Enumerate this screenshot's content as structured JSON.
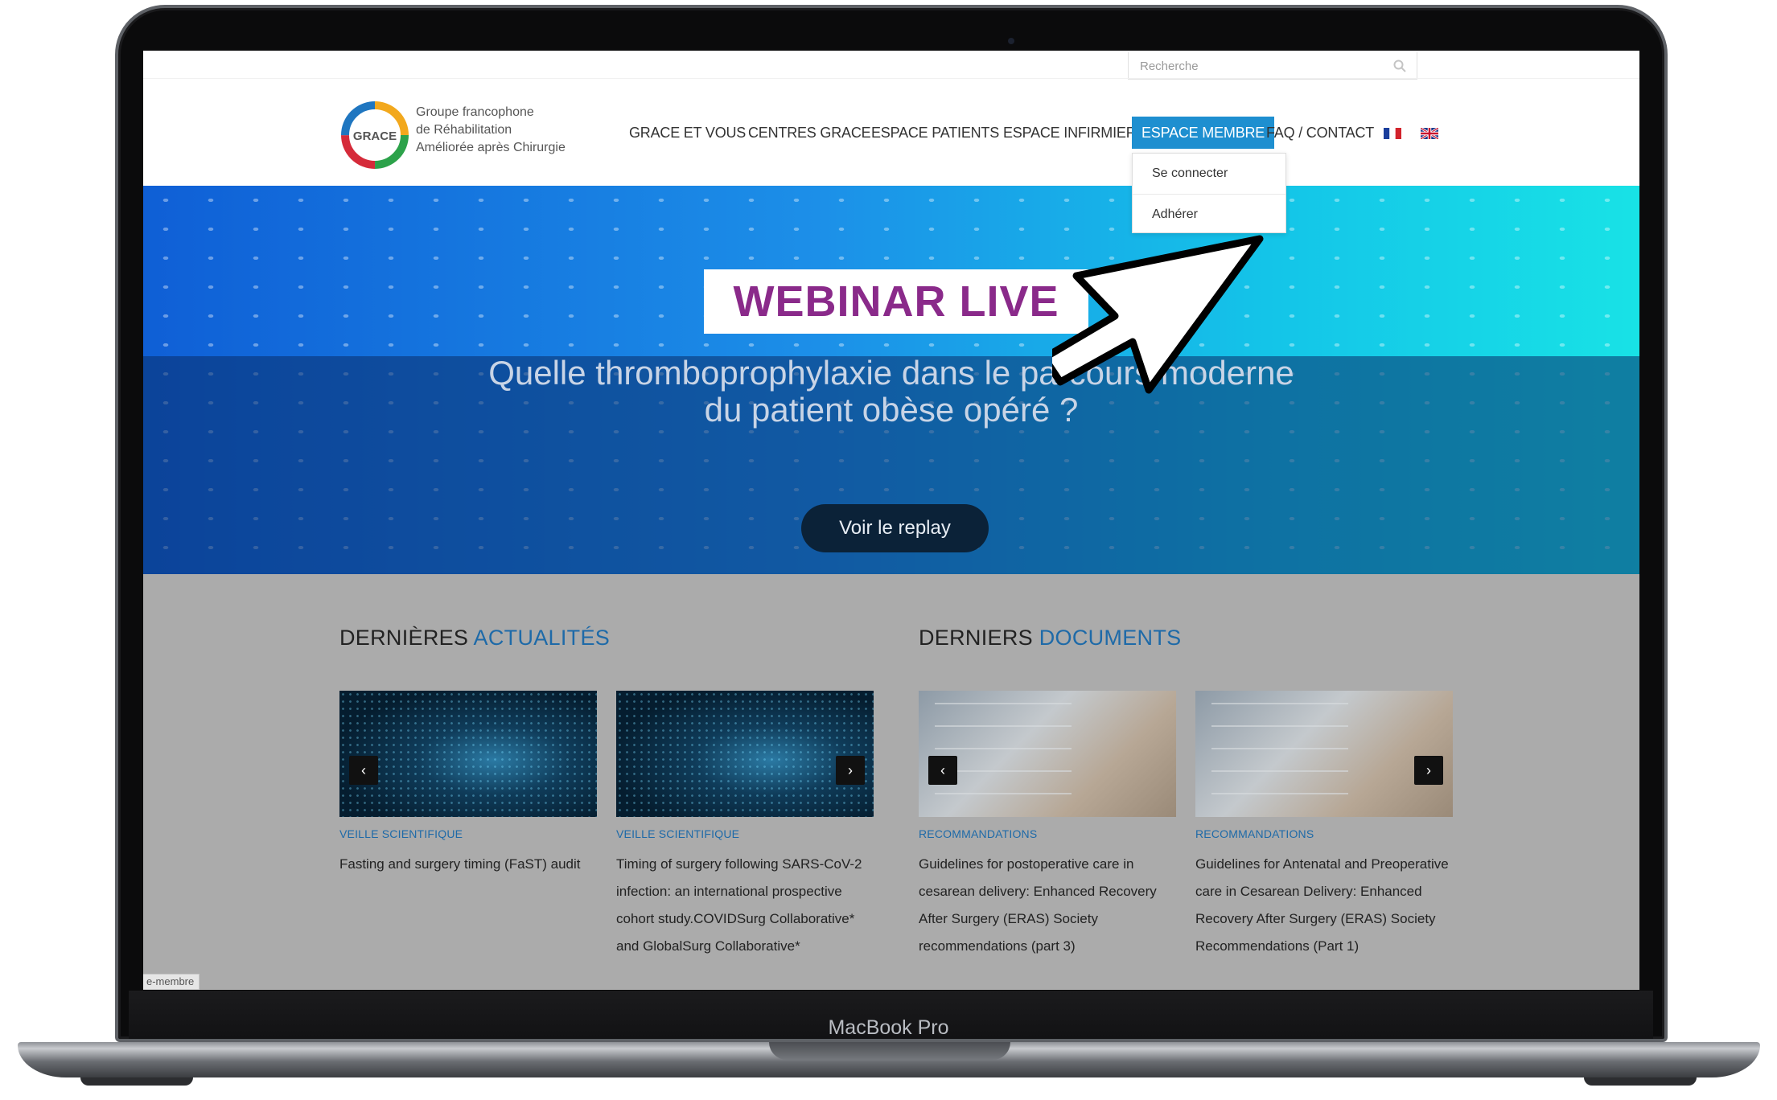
{
  "device": {
    "label": "MacBook Pro"
  },
  "search": {
    "placeholder": "Recherche"
  },
  "logo": {
    "badge": "GRACE",
    "line1": "Groupe francophone",
    "line2": "de Réhabilitation",
    "line3": "Améliorée après Chirurgie"
  },
  "nav": {
    "items": [
      {
        "label": "GRACE ET VOUS"
      },
      {
        "label": "CENTRES GRACE"
      },
      {
        "label": "ESPACE PATIENTS"
      },
      {
        "label": "ESPACE INFIRMIER"
      },
      {
        "label": "ESPACE MEMBRE"
      },
      {
        "label": "FAQ / CONTACT"
      }
    ],
    "flags": [
      "french-flag-icon",
      "uk-flag-icon"
    ]
  },
  "dropdown": {
    "items": [
      {
        "label": "Se connecter"
      },
      {
        "label": "Adhérer"
      }
    ]
  },
  "hero": {
    "badge": "WEBINAR LIVE",
    "title_line1": "Quelle thromboprophylaxie dans le parcours moderne",
    "title_line2": "du patient obèse opéré ?",
    "button": "Voir le replay",
    "slides": 5,
    "current_slide": 1
  },
  "news": {
    "title_plain": "DERNIÈRES ",
    "title_accent": "ACTUALITÉS",
    "cards": [
      {
        "category": "VEILLE SCIENTIFIQUE",
        "title": "Fasting and surgery timing (FaST) audit"
      },
      {
        "category": "VEILLE SCIENTIFIQUE",
        "title": "Timing of surgery following SARS-CoV-2 infection: an international prospective cohort study.COVIDSurg Collaborative* and GlobalSurg Collaborative*"
      }
    ]
  },
  "docs": {
    "title_plain": "DERNIERS ",
    "title_accent": "DOCUMENTS",
    "cards": [
      {
        "category": "RECOMMANDATIONS",
        "title": "Guidelines for postoperative care in cesarean delivery: Enhanced Recovery After Surgery (ERAS) Society recommendations (part 3)"
      },
      {
        "category": "RECOMMANDATIONS",
        "title": "Guidelines for Antenatal and Preoperative care in Cesarean Delivery: Enhanced Recovery After Surgery (ERAS) Society Recommendations (Part 1)"
      }
    ]
  },
  "status_link": "e-membre",
  "colors": {
    "accent": "#1e8fd0",
    "section_accent": "#1e6aa8",
    "badge_text": "#8a2a8a",
    "button_bg": "#0b2238"
  }
}
